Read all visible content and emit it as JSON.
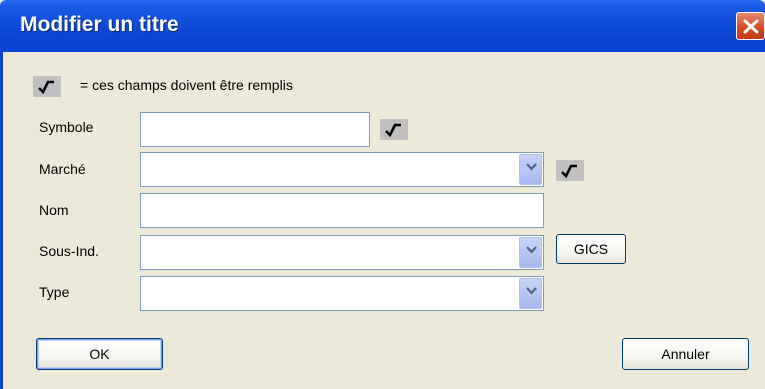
{
  "window": {
    "title": "Modifier un titre"
  },
  "icons": {
    "close": "close-icon",
    "required": "check-icon",
    "dropdown": "chevron-down-icon"
  },
  "legend": {
    "text": "= ces champs doivent être remplis"
  },
  "form": {
    "symbole": {
      "label": "Symbole",
      "value": ""
    },
    "marche": {
      "label": "Marché",
      "value": ""
    },
    "nom": {
      "label": "Nom",
      "value": ""
    },
    "sous_ind": {
      "label": "Sous-Ind.",
      "value": ""
    },
    "type": {
      "label": "Type",
      "value": ""
    }
  },
  "buttons": {
    "gics": "GICS",
    "ok": "OK",
    "cancel": "Annuler"
  },
  "colors": {
    "titlebar": "#0a40cb",
    "dialog_bg": "#ece9d8",
    "close": "#d44720"
  }
}
